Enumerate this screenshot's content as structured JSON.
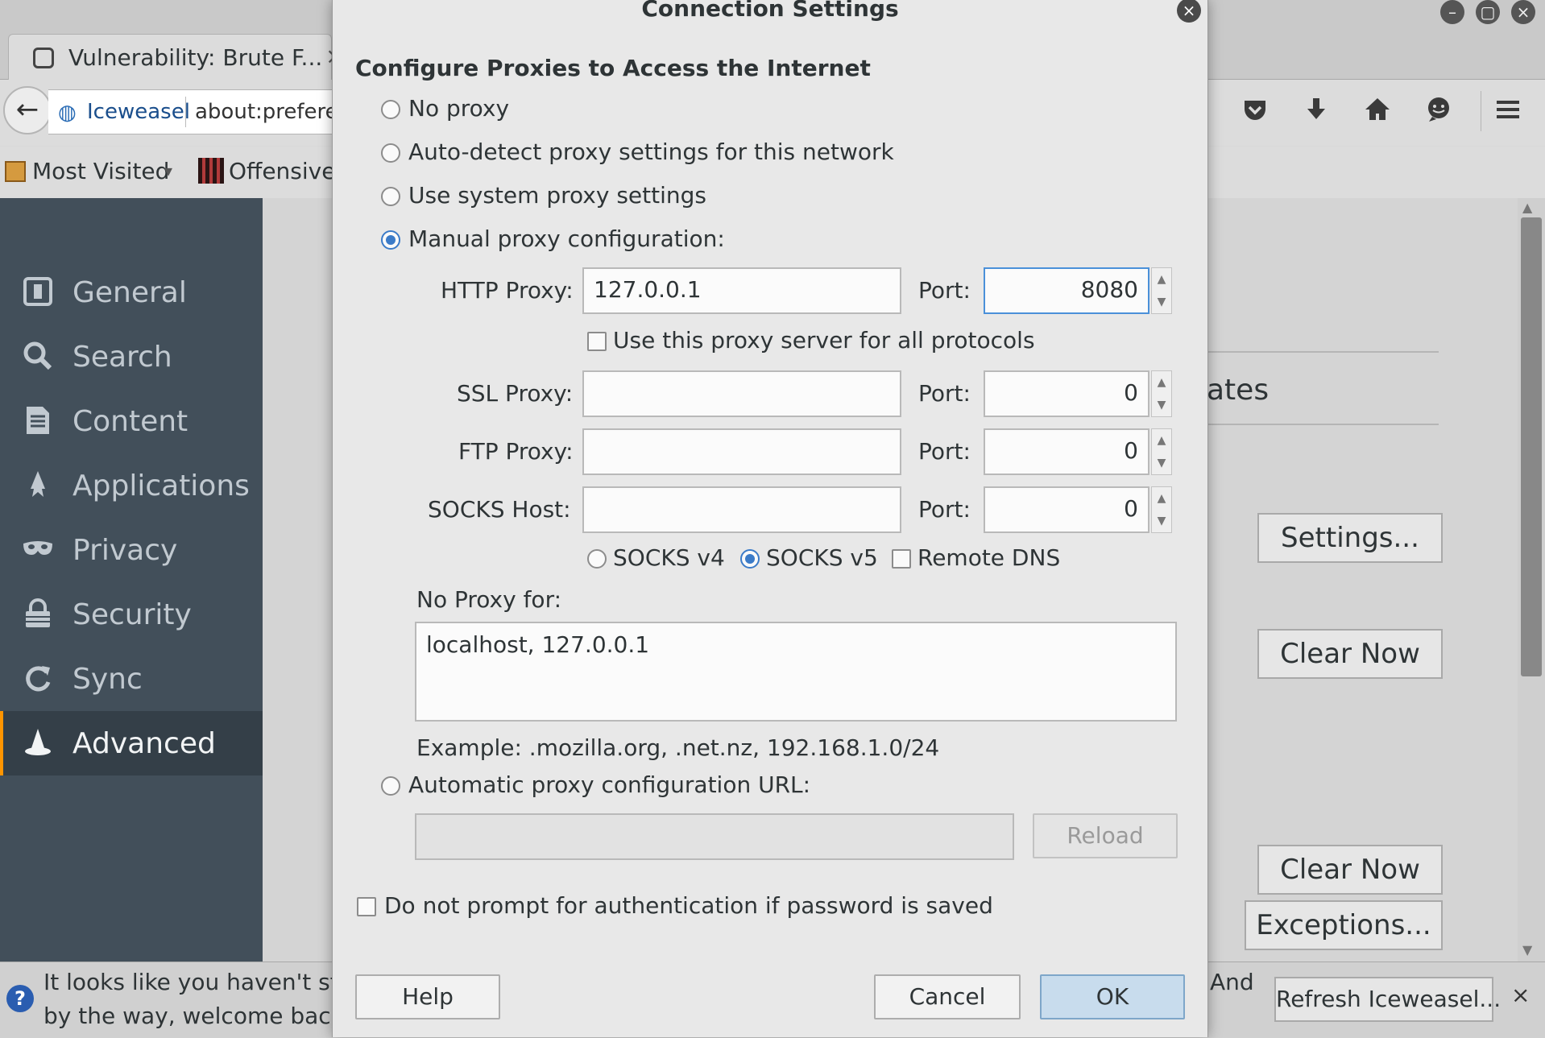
{
  "browser": {
    "tab_title": "Vulnerability: Brute F...",
    "tab_close": "×",
    "url_site": "Iceweasel",
    "url_address": "about:prefere",
    "bookmarks": [
      "Most Visited",
      "Offensive"
    ],
    "bookmark_dropdown": "▾",
    "window_buttons": [
      "–",
      "▢",
      "×"
    ]
  },
  "sidebar": {
    "items": [
      {
        "label": "General",
        "icon": "general-icon"
      },
      {
        "label": "Search",
        "icon": "search-icon"
      },
      {
        "label": "Content",
        "icon": "content-icon"
      },
      {
        "label": "Applications",
        "icon": "applications-icon"
      },
      {
        "label": "Privacy",
        "icon": "privacy-mask-icon"
      },
      {
        "label": "Security",
        "icon": "security-lock-icon"
      },
      {
        "label": "Sync",
        "icon": "sync-icon"
      },
      {
        "label": "Advanced",
        "icon": "advanced-wizard-icon"
      }
    ],
    "active": "Advanced"
  },
  "background_content": {
    "partial_heading": "ates",
    "settings_button": "Settings...",
    "clear_now_1": "Clear Now",
    "clear_now_2": "Clear Now",
    "exceptions_button": "Exceptions..."
  },
  "notification": {
    "line1": "It looks like you haven't start",
    "line2": "by the way, welcome back!",
    "line3": "And",
    "refresh_button": "Refresh Iceweasel...",
    "close": "×"
  },
  "dialog": {
    "title": "Connection Settings",
    "close": "×",
    "heading": "Configure Proxies to Access the Internet",
    "options": {
      "no_proxy": "No proxy",
      "auto_detect": "Auto-detect proxy settings for this network",
      "system": "Use system proxy settings",
      "manual": "Manual proxy configuration:",
      "auto_url": "Automatic proxy configuration URL:"
    },
    "selected_option": "manual",
    "http_label": "HTTP Proxy:",
    "http_value": "127.0.0.1",
    "http_port": "8080",
    "use_for_all": "Use this proxy server for all protocols",
    "ssl_label": "SSL Proxy:",
    "ssl_value": "",
    "ssl_port": "0",
    "ftp_label": "FTP Proxy:",
    "ftp_value": "",
    "ftp_port": "0",
    "socks_label": "SOCKS Host:",
    "socks_value": "",
    "socks_port": "0",
    "port_label": "Port:",
    "socks_v4": "SOCKS v4",
    "socks_v5": "SOCKS v5",
    "socks_selected": "v5",
    "remote_dns": "Remote DNS",
    "no_proxy_for_label": "No Proxy for:",
    "no_proxy_for_value": "localhost, 127.0.0.1",
    "example": "Example: .mozilla.org, .net.nz, 192.168.1.0/24",
    "auto_url_value": "",
    "reload_button": "Reload",
    "no_prompt_auth": "Do not prompt for authentication if password is saved",
    "help_button": "Help",
    "cancel_button": "Cancel",
    "ok_button": "OK",
    "spin_up": "▲",
    "spin_down": "▼"
  }
}
